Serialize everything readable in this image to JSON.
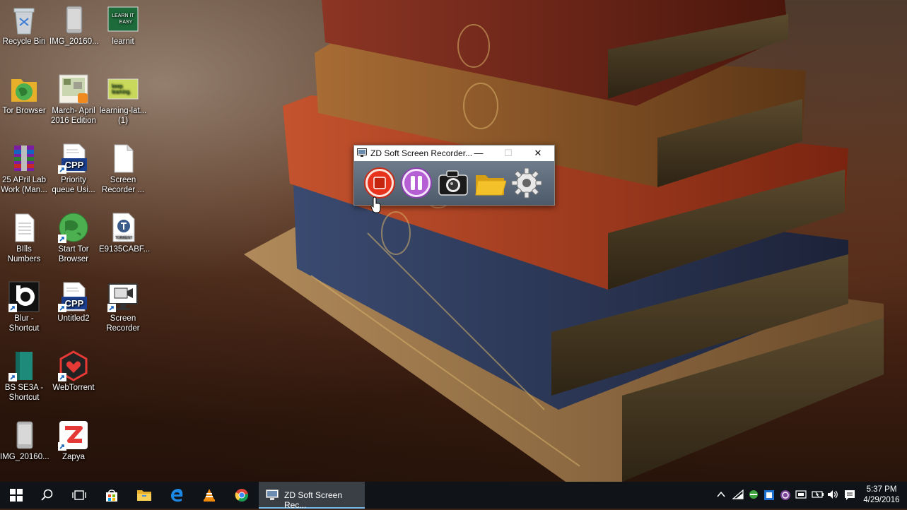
{
  "desktop": {
    "icons": [
      {
        "id": "recycle-bin",
        "label": "Recycle Bin"
      },
      {
        "id": "img1",
        "label": "IMG_20160..."
      },
      {
        "id": "learnit",
        "label": "learnit"
      },
      {
        "id": "tor-browser",
        "label": "Tor Browser"
      },
      {
        "id": "march-april",
        "label": "March- April\n2016 Edition"
      },
      {
        "id": "learning-lat",
        "label": "learning-lat...\n(1)"
      },
      {
        "id": "lab-work",
        "label": "25 APril Lab\nWork (Man..."
      },
      {
        "id": "priority-queue",
        "label": "Priority\nqueue Usi..."
      },
      {
        "id": "screen-recorder-doc",
        "label": "Screen\nRecorder ..."
      },
      {
        "id": "bills-numbers",
        "label": "BIlls\nNumbers"
      },
      {
        "id": "start-tor",
        "label": "Start Tor\nBrowser"
      },
      {
        "id": "torrent-file",
        "label": "E9135CABF..."
      },
      {
        "id": "blur-shortcut",
        "label": "Blur -\nShortcut"
      },
      {
        "id": "untitled2",
        "label": "Untitled2"
      },
      {
        "id": "screen-recorder-app",
        "label": "Screen\nRecorder"
      },
      {
        "id": "bs-se3a",
        "label": "BS SE3A -\nShortcut"
      },
      {
        "id": "webtorrent",
        "label": "WebTorrent"
      },
      {
        "id": "img2",
        "label": "IMG_20160..."
      },
      {
        "id": "zapya",
        "label": "Zapya"
      }
    ],
    "learnit_thumb_text": "LEARN IT\nEASY",
    "learning_thumb_text": "keep\nlearning.",
    "cpp_badge": "CPP",
    "torrent_badge": "TORRENT"
  },
  "recorder_window": {
    "title": "ZD Soft Screen Recorder...",
    "buttons": [
      {
        "id": "stop",
        "icon": "stop-record-icon"
      },
      {
        "id": "pause",
        "icon": "pause-icon"
      },
      {
        "id": "snapshot",
        "icon": "camera-icon"
      },
      {
        "id": "folder",
        "icon": "folder-icon"
      },
      {
        "id": "settings",
        "icon": "gear-icon"
      }
    ],
    "colors": {
      "stop": "#e8331c",
      "pause": "#b65fd4",
      "folder": "#f3c12a"
    }
  },
  "taskbar": {
    "active_app_label": "ZD Soft Screen Rec...",
    "pinned": [
      "start-icon",
      "search-icon",
      "task-view-icon",
      "store-icon",
      "file-explorer-icon",
      "edge-icon",
      "vlc-icon",
      "chrome-icon"
    ],
    "clock": {
      "time": "5:37 PM",
      "date": "4/29/2016"
    },
    "accent": "#76b9ed"
  }
}
